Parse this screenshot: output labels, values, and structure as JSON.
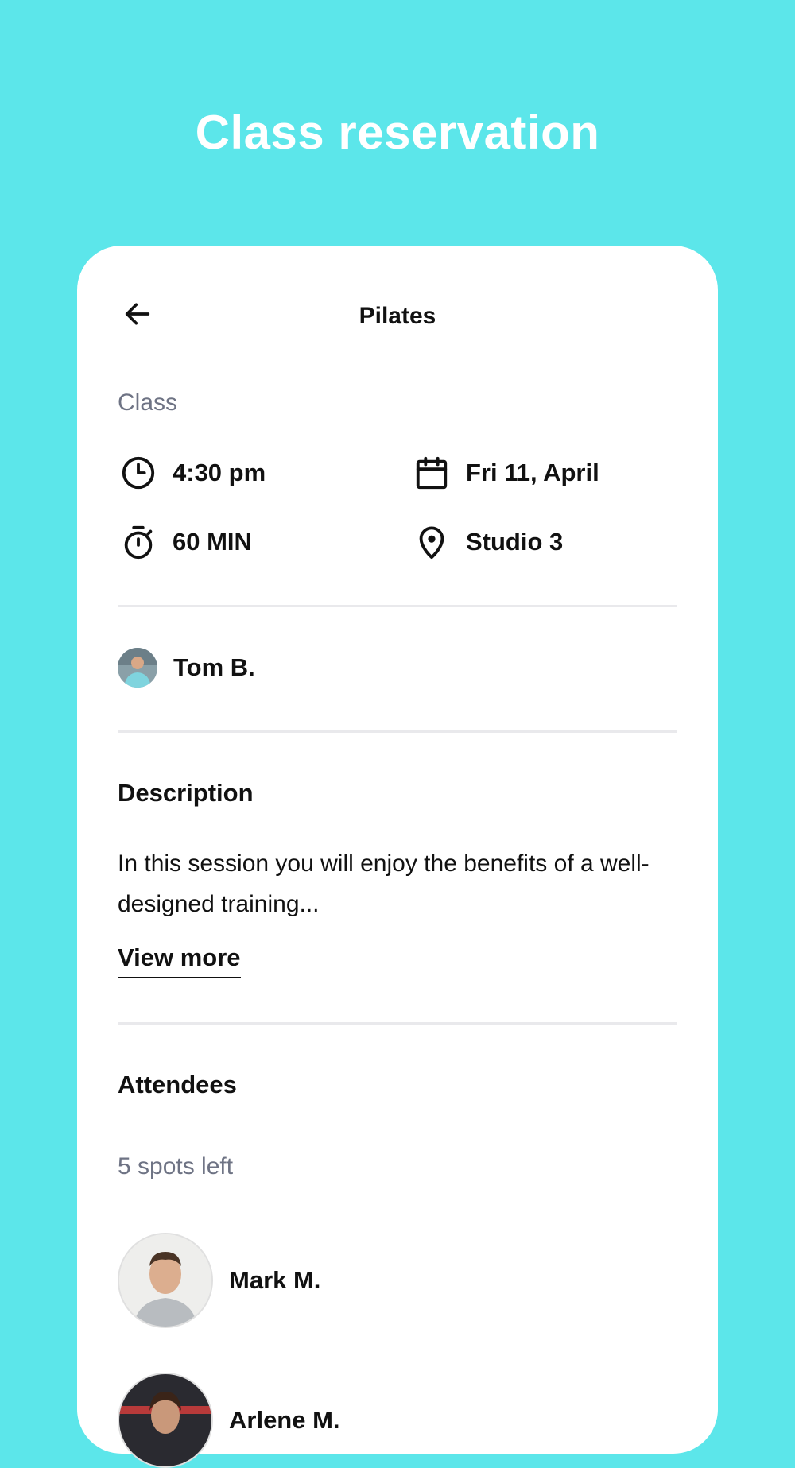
{
  "header": {
    "title": "Class reservation"
  },
  "topbar": {
    "title": "Pilates"
  },
  "class_section": {
    "label": "Class",
    "time": "4:30 pm",
    "date": "Fri 11, April",
    "duration": "60 MIN",
    "location": "Studio 3"
  },
  "trainer": {
    "name": "Tom B."
  },
  "description": {
    "heading": "Description",
    "text": "In this session you will enjoy the benefits of a well-designed training...",
    "view_more": "View more"
  },
  "attendees": {
    "heading": "Attendees",
    "spots_left": "5 spots left",
    "list": [
      {
        "name": "Mark M."
      },
      {
        "name": "Arlene M."
      }
    ]
  },
  "colors": {
    "background": "#5ce6ea",
    "card": "#ffffff",
    "muted_text": "#6e7384"
  }
}
